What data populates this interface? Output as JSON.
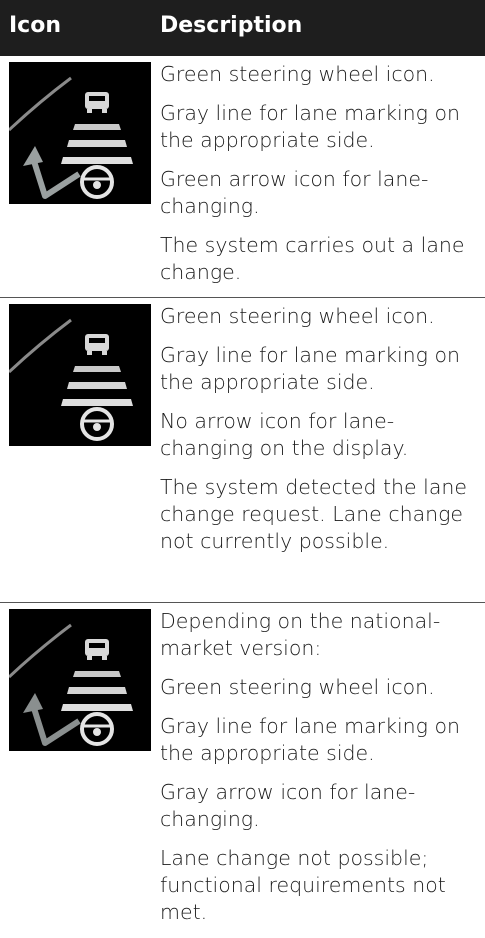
{
  "header": {
    "icon_col": "Icon",
    "desc_col": "Description"
  },
  "rows": [
    {
      "icon": "lane-change-active-icon",
      "lines": [
        "Green steering wheel icon.",
        "Gray line for lane marking on the appropriate side.",
        "Green arrow icon for lane-changing.",
        "The system carries out a lane change."
      ]
    },
    {
      "icon": "lane-change-detected-icon",
      "lines": [
        "Green steering wheel icon.",
        "Gray line for lane marking on the appropriate side.",
        "No arrow icon for lane-changing on the display.",
        "The system detected the lane change request. Lane change not currently possible."
      ]
    },
    {
      "icon": "lane-change-not-possible-icon",
      "lines": [
        "Depending on the national-market version:",
        "Green steering wheel icon.",
        "Gray line for lane marking on the appropriate side.",
        "Gray arrow icon for lane-changing.",
        "Lane change not possible; functional requirements not met."
      ]
    }
  ]
}
